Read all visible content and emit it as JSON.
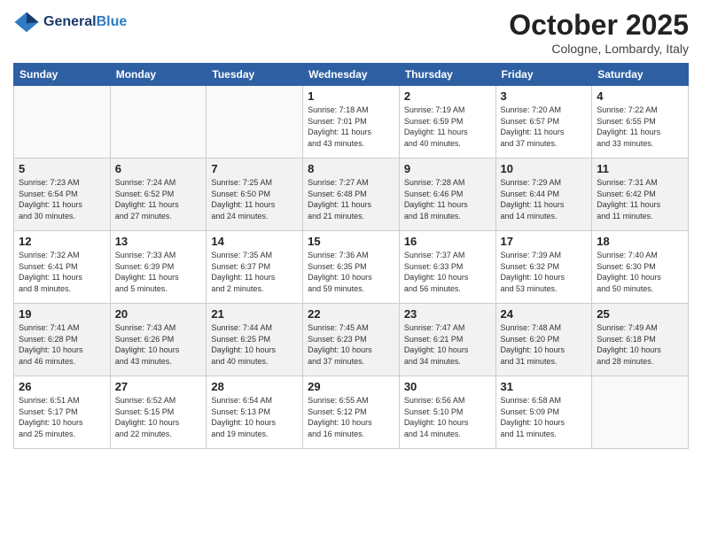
{
  "header": {
    "logo_line1": "General",
    "logo_line2": "Blue",
    "month": "October 2025",
    "location": "Cologne, Lombardy, Italy"
  },
  "days_of_week": [
    "Sunday",
    "Monday",
    "Tuesday",
    "Wednesday",
    "Thursday",
    "Friday",
    "Saturday"
  ],
  "weeks": [
    [
      {
        "day": "",
        "info": ""
      },
      {
        "day": "",
        "info": ""
      },
      {
        "day": "",
        "info": ""
      },
      {
        "day": "1",
        "info": "Sunrise: 7:18 AM\nSunset: 7:01 PM\nDaylight: 11 hours\nand 43 minutes."
      },
      {
        "day": "2",
        "info": "Sunrise: 7:19 AM\nSunset: 6:59 PM\nDaylight: 11 hours\nand 40 minutes."
      },
      {
        "day": "3",
        "info": "Sunrise: 7:20 AM\nSunset: 6:57 PM\nDaylight: 11 hours\nand 37 minutes."
      },
      {
        "day": "4",
        "info": "Sunrise: 7:22 AM\nSunset: 6:55 PM\nDaylight: 11 hours\nand 33 minutes."
      }
    ],
    [
      {
        "day": "5",
        "info": "Sunrise: 7:23 AM\nSunset: 6:54 PM\nDaylight: 11 hours\nand 30 minutes."
      },
      {
        "day": "6",
        "info": "Sunrise: 7:24 AM\nSunset: 6:52 PM\nDaylight: 11 hours\nand 27 minutes."
      },
      {
        "day": "7",
        "info": "Sunrise: 7:25 AM\nSunset: 6:50 PM\nDaylight: 11 hours\nand 24 minutes."
      },
      {
        "day": "8",
        "info": "Sunrise: 7:27 AM\nSunset: 6:48 PM\nDaylight: 11 hours\nand 21 minutes."
      },
      {
        "day": "9",
        "info": "Sunrise: 7:28 AM\nSunset: 6:46 PM\nDaylight: 11 hours\nand 18 minutes."
      },
      {
        "day": "10",
        "info": "Sunrise: 7:29 AM\nSunset: 6:44 PM\nDaylight: 11 hours\nand 14 minutes."
      },
      {
        "day": "11",
        "info": "Sunrise: 7:31 AM\nSunset: 6:42 PM\nDaylight: 11 hours\nand 11 minutes."
      }
    ],
    [
      {
        "day": "12",
        "info": "Sunrise: 7:32 AM\nSunset: 6:41 PM\nDaylight: 11 hours\nand 8 minutes."
      },
      {
        "day": "13",
        "info": "Sunrise: 7:33 AM\nSunset: 6:39 PM\nDaylight: 11 hours\nand 5 minutes."
      },
      {
        "day": "14",
        "info": "Sunrise: 7:35 AM\nSunset: 6:37 PM\nDaylight: 11 hours\nand 2 minutes."
      },
      {
        "day": "15",
        "info": "Sunrise: 7:36 AM\nSunset: 6:35 PM\nDaylight: 10 hours\nand 59 minutes."
      },
      {
        "day": "16",
        "info": "Sunrise: 7:37 AM\nSunset: 6:33 PM\nDaylight: 10 hours\nand 56 minutes."
      },
      {
        "day": "17",
        "info": "Sunrise: 7:39 AM\nSunset: 6:32 PM\nDaylight: 10 hours\nand 53 minutes."
      },
      {
        "day": "18",
        "info": "Sunrise: 7:40 AM\nSunset: 6:30 PM\nDaylight: 10 hours\nand 50 minutes."
      }
    ],
    [
      {
        "day": "19",
        "info": "Sunrise: 7:41 AM\nSunset: 6:28 PM\nDaylight: 10 hours\nand 46 minutes."
      },
      {
        "day": "20",
        "info": "Sunrise: 7:43 AM\nSunset: 6:26 PM\nDaylight: 10 hours\nand 43 minutes."
      },
      {
        "day": "21",
        "info": "Sunrise: 7:44 AM\nSunset: 6:25 PM\nDaylight: 10 hours\nand 40 minutes."
      },
      {
        "day": "22",
        "info": "Sunrise: 7:45 AM\nSunset: 6:23 PM\nDaylight: 10 hours\nand 37 minutes."
      },
      {
        "day": "23",
        "info": "Sunrise: 7:47 AM\nSunset: 6:21 PM\nDaylight: 10 hours\nand 34 minutes."
      },
      {
        "day": "24",
        "info": "Sunrise: 7:48 AM\nSunset: 6:20 PM\nDaylight: 10 hours\nand 31 minutes."
      },
      {
        "day": "25",
        "info": "Sunrise: 7:49 AM\nSunset: 6:18 PM\nDaylight: 10 hours\nand 28 minutes."
      }
    ],
    [
      {
        "day": "26",
        "info": "Sunrise: 6:51 AM\nSunset: 5:17 PM\nDaylight: 10 hours\nand 25 minutes."
      },
      {
        "day": "27",
        "info": "Sunrise: 6:52 AM\nSunset: 5:15 PM\nDaylight: 10 hours\nand 22 minutes."
      },
      {
        "day": "28",
        "info": "Sunrise: 6:54 AM\nSunset: 5:13 PM\nDaylight: 10 hours\nand 19 minutes."
      },
      {
        "day": "29",
        "info": "Sunrise: 6:55 AM\nSunset: 5:12 PM\nDaylight: 10 hours\nand 16 minutes."
      },
      {
        "day": "30",
        "info": "Sunrise: 6:56 AM\nSunset: 5:10 PM\nDaylight: 10 hours\nand 14 minutes."
      },
      {
        "day": "31",
        "info": "Sunrise: 6:58 AM\nSunset: 5:09 PM\nDaylight: 10 hours\nand 11 minutes."
      },
      {
        "day": "",
        "info": ""
      }
    ]
  ]
}
